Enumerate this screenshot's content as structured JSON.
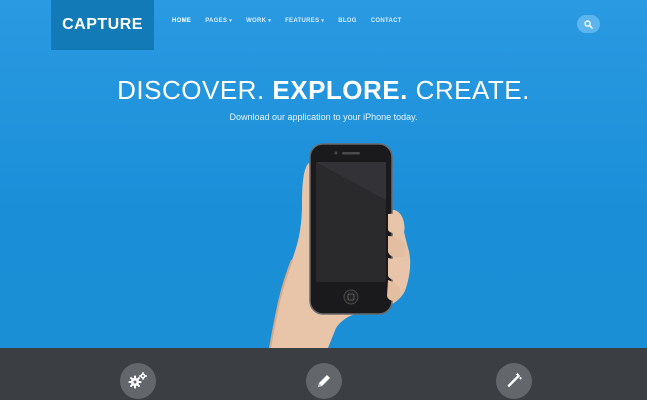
{
  "brand": {
    "logo_text": "CAPTURE"
  },
  "nav": {
    "items": [
      {
        "label": "HOME",
        "has_dropdown": false,
        "active": true
      },
      {
        "label": "PAGES",
        "has_dropdown": true,
        "active": false
      },
      {
        "label": "WORK",
        "has_dropdown": true,
        "active": false
      },
      {
        "label": "FEATURES",
        "has_dropdown": true,
        "active": false
      },
      {
        "label": "BLOG",
        "has_dropdown": false,
        "active": false
      },
      {
        "label": "CONTACT",
        "has_dropdown": false,
        "active": false
      }
    ],
    "caret": "▾",
    "search_icon": "search-icon"
  },
  "hero": {
    "headline_part1": "DISCOVER. ",
    "headline_bold": "EXPLORE.",
    "headline_part3": " CREATE.",
    "subline": "Download our application to your iPhone today."
  },
  "features": {
    "icons": [
      "gears-icon",
      "pencil-icon",
      "magic-wand-icon"
    ]
  },
  "colors": {
    "hero_bg": "#1e90d6",
    "logo_bg": "#137ab8",
    "footer_bg": "#3b3e42",
    "feature_circle": "#63666b"
  }
}
